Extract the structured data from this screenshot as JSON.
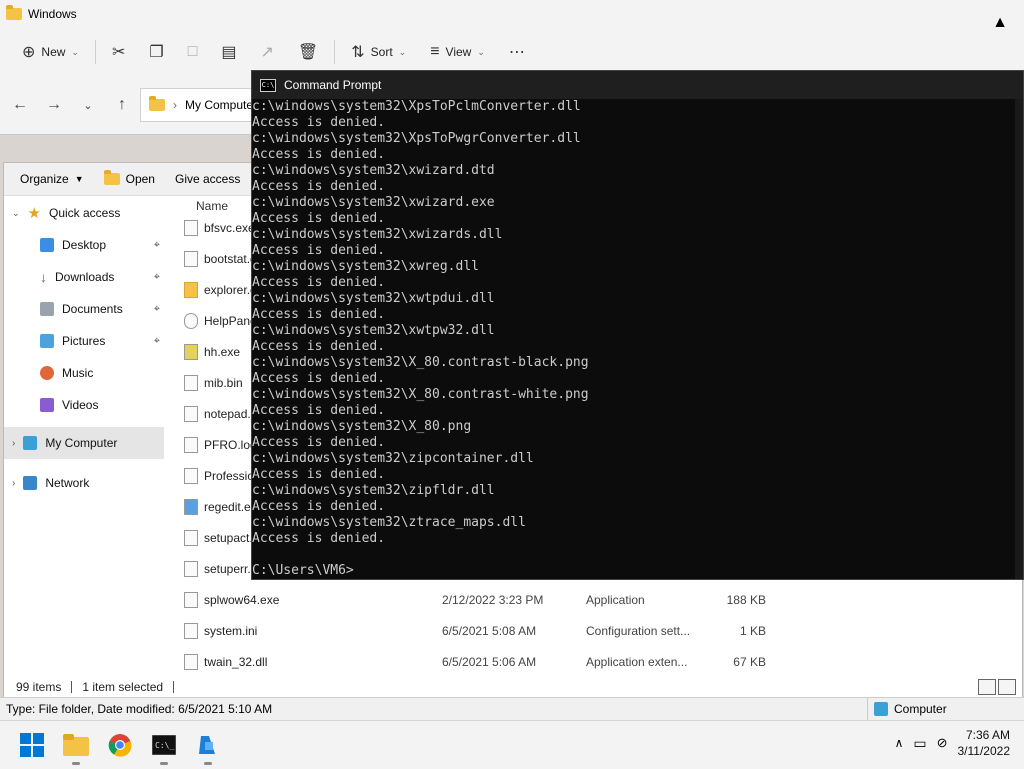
{
  "top_window": {
    "title": "Windows",
    "commands": [
      "New",
      "Sort",
      "View"
    ],
    "address": "My Computer"
  },
  "explorer": {
    "toolbar": [
      "Organize",
      "Open",
      "Give access"
    ],
    "column_name": "Name",
    "nav_items": [
      {
        "label": "Quick access",
        "icon": "star-icon"
      },
      {
        "label": "Desktop",
        "icon": "desktop-icon"
      },
      {
        "label": "Downloads",
        "icon": "downloads-icon"
      },
      {
        "label": "Documents",
        "icon": "documents-icon"
      },
      {
        "label": "Pictures",
        "icon": "pictures-icon"
      },
      {
        "label": "Music",
        "icon": "music-icon"
      },
      {
        "label": "Videos",
        "icon": "videos-icon"
      },
      {
        "label": "My Computer",
        "icon": "computer-icon"
      },
      {
        "label": "Network",
        "icon": "network-icon"
      }
    ],
    "files": [
      {
        "name": "bfsvc.exe",
        "date": "",
        "type": "",
        "size": ""
      },
      {
        "name": "bootstat.d",
        "date": "",
        "type": "",
        "size": ""
      },
      {
        "name": "explorer.e",
        "date": "",
        "type": "",
        "size": ""
      },
      {
        "name": "HelpPane",
        "date": "",
        "type": "",
        "size": ""
      },
      {
        "name": "hh.exe",
        "date": "",
        "type": "",
        "size": ""
      },
      {
        "name": "mib.bin",
        "date": "",
        "type": "",
        "size": ""
      },
      {
        "name": "notepad.e",
        "date": "",
        "type": "",
        "size": ""
      },
      {
        "name": "PFRO.log",
        "date": "",
        "type": "",
        "size": ""
      },
      {
        "name": "Profession",
        "date": "",
        "type": "",
        "size": ""
      },
      {
        "name": "regedit.ex",
        "date": "",
        "type": "",
        "size": ""
      },
      {
        "name": "setupact.l",
        "date": "",
        "type": "",
        "size": ""
      },
      {
        "name": "setuperr.l",
        "date": "",
        "type": "",
        "size": ""
      },
      {
        "name": "splwow64.exe",
        "date": "2/12/2022 3:23 PM",
        "type": "Application",
        "size": "188 KB"
      },
      {
        "name": "system.ini",
        "date": "6/5/2021 5:08 AM",
        "type": "Configuration sett...",
        "size": "1 KB"
      },
      {
        "name": "twain_32.dll",
        "date": "6/5/2021 5:06 AM",
        "type": "Application exten...",
        "size": "67 KB"
      }
    ],
    "status_items": "99 items",
    "status_selected": "1 item selected"
  },
  "detail_bar": {
    "text": "Type: File folder, Date modified: 6/5/2021 5:10 AM",
    "location": "Computer"
  },
  "cmd": {
    "title": "Command Prompt",
    "lines": [
      "c:\\windows\\system32\\XpsToPclmConverter.dll",
      "Access is denied.",
      "c:\\windows\\system32\\XpsToPwgrConverter.dll",
      "Access is denied.",
      "c:\\windows\\system32\\xwizard.dtd",
      "Access is denied.",
      "c:\\windows\\system32\\xwizard.exe",
      "Access is denied.",
      "c:\\windows\\system32\\xwizards.dll",
      "Access is denied.",
      "c:\\windows\\system32\\xwreg.dll",
      "Access is denied.",
      "c:\\windows\\system32\\xwtpdui.dll",
      "Access is denied.",
      "c:\\windows\\system32\\xwtpw32.dll",
      "Access is denied.",
      "c:\\windows\\system32\\X_80.contrast-black.png",
      "Access is denied.",
      "c:\\windows\\system32\\X_80.contrast-white.png",
      "Access is denied.",
      "c:\\windows\\system32\\X_80.png",
      "Access is denied.",
      "c:\\windows\\system32\\zipcontainer.dll",
      "Access is denied.",
      "c:\\windows\\system32\\zipfldr.dll",
      "Access is denied.",
      "c:\\windows\\system32\\ztrace_maps.dll",
      "Access is denied.",
      "",
      "C:\\Users\\VM6>"
    ]
  },
  "taskbar": {
    "apps": [
      "start-icon",
      "file-explorer-icon",
      "chrome-icon",
      "terminal-icon",
      "azure-icon"
    ],
    "time": "7:36 AM",
    "date": "3/11/2022"
  },
  "colors": {
    "accent": "#0078d4",
    "cmd_bg": "#0c0c0c",
    "cmd_text": "#cccccc"
  }
}
